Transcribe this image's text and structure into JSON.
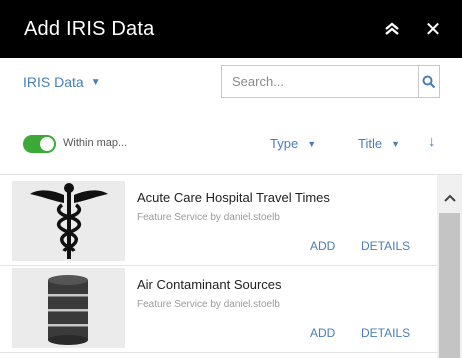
{
  "header": {
    "title": "Add IRIS Data",
    "collapse_icon": "double-chevron-up-icon",
    "close_icon": "close-icon",
    "close_glyph": "✕"
  },
  "filters": {
    "source_label": "IRIS Data",
    "search_placeholder": "Search..."
  },
  "sort_bar": {
    "within_map_label": "Within map...",
    "within_map_enabled": true,
    "type_label": "Type",
    "title_label": "Title",
    "sort_direction": "descending"
  },
  "results": [
    {
      "title": "Acute Care Hospital Travel Times",
      "meta": "Feature Service by daniel.stoelb",
      "thumbnail_icon": "caduceus-icon",
      "add_label": "ADD",
      "details_label": "DETAILS"
    },
    {
      "title": "Air Contaminant Sources",
      "meta": "Feature Service by daniel.stoelb",
      "thumbnail_icon": "barrel-icon",
      "add_label": "ADD",
      "details_label": "DETAILS"
    }
  ],
  "colors": {
    "header_bg": "#000000",
    "link": "#4a7fb5",
    "toggle_on": "#3aa935"
  }
}
